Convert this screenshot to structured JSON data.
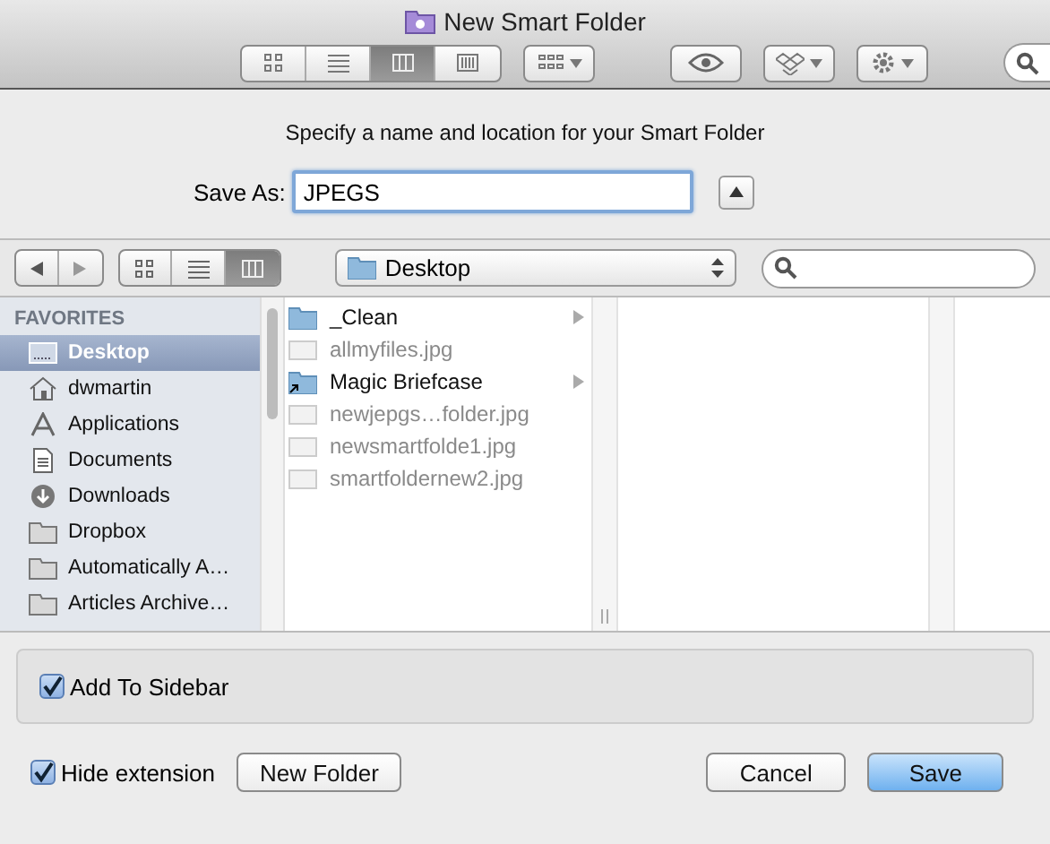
{
  "window": {
    "title": "New Smart Folder"
  },
  "toolbar": {
    "view_buttons": [
      {
        "kind": "icons",
        "selected": false
      },
      {
        "kind": "list",
        "selected": false
      },
      {
        "kind": "columns",
        "selected": true
      },
      {
        "kind": "coverflow",
        "selected": false
      }
    ]
  },
  "sheet": {
    "prompt": "Specify a name and location for your Smart Folder",
    "save_as": {
      "label": "Save As:",
      "value": "JPEGS",
      "expanded": true
    }
  },
  "browser_toolbar": {
    "view_buttons": [
      {
        "kind": "icons",
        "selected": false
      },
      {
        "kind": "list",
        "selected": false
      },
      {
        "kind": "columns",
        "selected": true
      }
    ],
    "location": "Desktop"
  },
  "sidebar": {
    "heading": "FAVORITES",
    "items": [
      {
        "label": "Desktop",
        "kind": "desktop",
        "selected": true
      },
      {
        "label": "dwmartin",
        "kind": "home",
        "selected": false
      },
      {
        "label": "Applications",
        "kind": "apps",
        "selected": false
      },
      {
        "label": "Documents",
        "kind": "documents",
        "selected": false
      },
      {
        "label": "Downloads",
        "kind": "downloads",
        "selected": false
      },
      {
        "label": "Dropbox",
        "kind": "folder",
        "selected": false
      },
      {
        "label": "Automatically A…",
        "kind": "folder",
        "selected": false
      },
      {
        "label": "Articles Archive…",
        "kind": "folder",
        "selected": false
      }
    ]
  },
  "files": [
    {
      "name": "_Clean",
      "kind": "folder",
      "disabled": false
    },
    {
      "name": "allmyfiles.jpg",
      "kind": "file",
      "disabled": true
    },
    {
      "name": "Magic Briefcase",
      "kind": "alias",
      "disabled": false
    },
    {
      "name": "newjepgs…folder.jpg",
      "kind": "file",
      "disabled": true
    },
    {
      "name": "newsmartfolde1.jpg",
      "kind": "file",
      "disabled": true
    },
    {
      "name": "smartfoldernew2.jpg",
      "kind": "file",
      "disabled": true
    }
  ],
  "accessory": {
    "add_to_sidebar": {
      "label": "Add To Sidebar",
      "checked": true
    }
  },
  "footer": {
    "hide_extension": {
      "label": "Hide extension",
      "checked": true
    },
    "new_folder": "New Folder",
    "cancel": "Cancel",
    "save": "Save"
  }
}
